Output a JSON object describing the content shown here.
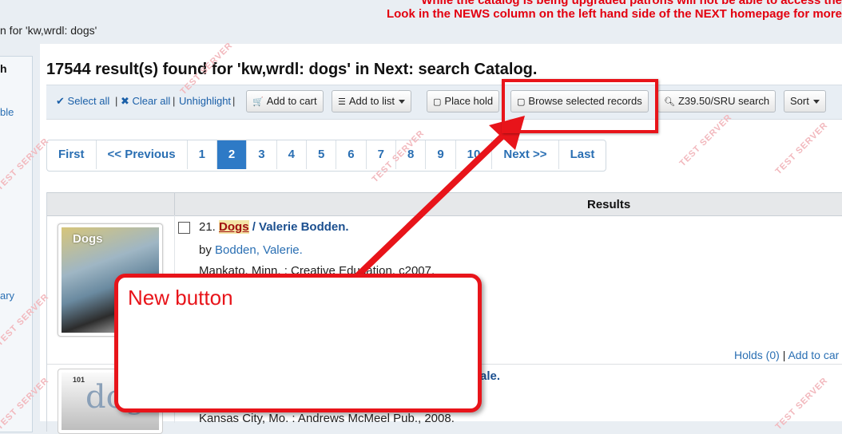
{
  "banner": {
    "line1": "While the catalog is being upgraded patrons will not be able to access the",
    "line2": "Look in the NEWS column on the left hand side of the NEXT homepage for more"
  },
  "breadcrumb": "n for 'kw,wrdl: dogs'",
  "sidebar": {
    "heading": "h",
    "item1": "ble",
    "item2": "ary"
  },
  "title": "17544 result(s) found for 'kw,wrdl: dogs' in Next: search Catalog.",
  "toolbar": {
    "select_all": "Select all",
    "clear_all": "Clear all",
    "unhighlight": "Unhighlight",
    "add_to_cart": "Add to cart",
    "add_to_list": "Add to list",
    "place_hold": "Place hold",
    "browse_selected": "Browse selected records",
    "z3950": "Z39.50/SRU search",
    "sort": "Sort"
  },
  "pagination": {
    "first": "First",
    "previous": "<< Previous",
    "pages": [
      "1",
      "2",
      "3",
      "4",
      "5",
      "6",
      "7",
      "8",
      "9",
      "10"
    ],
    "current": "2",
    "next": "Next >>",
    "last": "Last"
  },
  "results": {
    "header": "Results",
    "records": [
      {
        "number": "21.",
        "title_highlight": "Dogs",
        "title_rest": "/ Valerie Bodden.",
        "by": "by",
        "author": "Bodden, Valerie.",
        "publication": "Mankato, Minn. : Creative Education, c2007.",
        "cover_text": "Dogs",
        "holds": "Holds (0)",
        "add_to_cart": "Add to car"
      },
      {
        "title_tail": "ale.",
        "publication": "Kansas City, Mo. : Andrews McMeel Pub., 2008.",
        "cover_text": "101",
        "cover_big": "dog"
      }
    ]
  },
  "watermark": "TEST SERVER",
  "annotation": {
    "callout": "New button",
    "color": "#e8141a"
  }
}
